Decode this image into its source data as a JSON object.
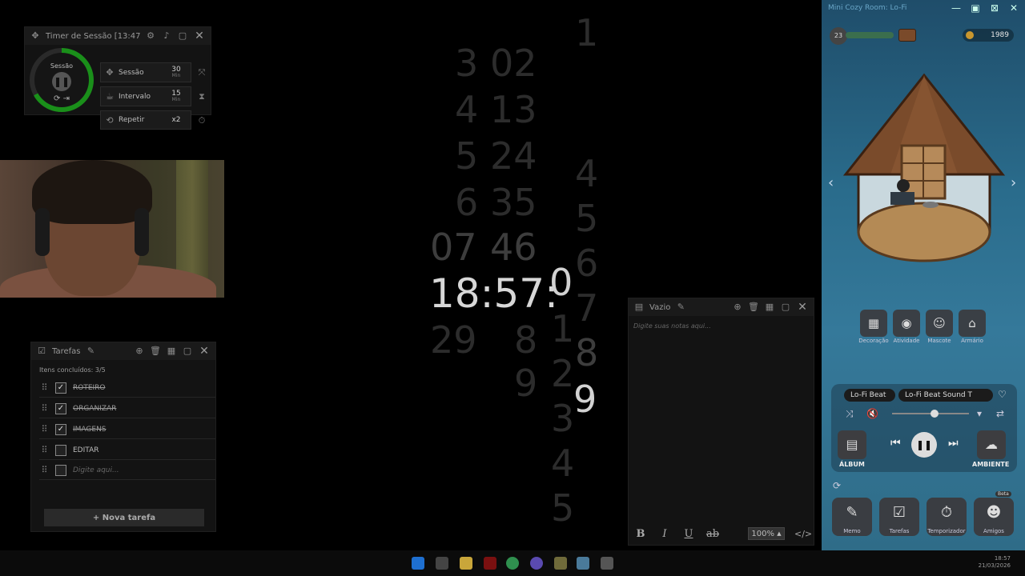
{
  "timer": {
    "title": "Timer de Sessão [13:47]",
    "ring_label": "Sessão",
    "ring_progress": 0.67,
    "rows": [
      {
        "label": "Sessão",
        "value": "30",
        "unit": "Min"
      },
      {
        "label": "Intervalo",
        "value": "15",
        "unit": "Min"
      },
      {
        "label": "Repetir",
        "value": "x2",
        "unit": ""
      }
    ]
  },
  "tasks": {
    "title": "Tarefas",
    "done_count": "Itens concluídos: 3/5",
    "items": [
      {
        "text": "ROTEIRO",
        "done": true
      },
      {
        "text": "ORGANIZAR",
        "done": true
      },
      {
        "text": "IMAGENS",
        "done": true
      },
      {
        "text": "EDITAR",
        "done": false
      }
    ],
    "input_placeholder": "Digite aqui...",
    "new_task_label": "+ Nova tarefa"
  },
  "clock": {
    "time": "18:57:",
    "seconds_column": "0",
    "second_next": "9",
    "col1": [
      "3",
      "4",
      "5",
      "6",
      "07",
      "29"
    ],
    "col2": [
      "02",
      "13",
      "24",
      "35",
      "46",
      "8",
      "9"
    ],
    "col3": [
      "1",
      "2",
      "3",
      "4",
      "5"
    ],
    "col4": [
      "1",
      "4",
      "5",
      "6",
      "7",
      "8"
    ]
  },
  "notes": {
    "title": "Vazio",
    "placeholder": "Digite suas notas aqui...",
    "format_buttons": [
      "B",
      "I",
      "U",
      "ab"
    ],
    "zoom": "100%"
  },
  "cozy": {
    "title": "Mini Cozy Room: Lo-Fi",
    "level": "23",
    "coins": "1989",
    "categories": [
      "Decoração",
      "Atividade",
      "Mascote",
      "Armário"
    ],
    "track_playlist": "Lo-Fi Beat",
    "track_name": "Lo-Fi Beat Sound T",
    "album_label": "ÁLBUM",
    "ambient_label": "AMBIENTE",
    "volume": 0.55,
    "dock": [
      "Memo",
      "Tarefas",
      "Temporizador",
      "Amigos"
    ],
    "beta_label": "Beta"
  },
  "taskbar": {
    "time": "18:57",
    "date": "21/03/2026"
  }
}
